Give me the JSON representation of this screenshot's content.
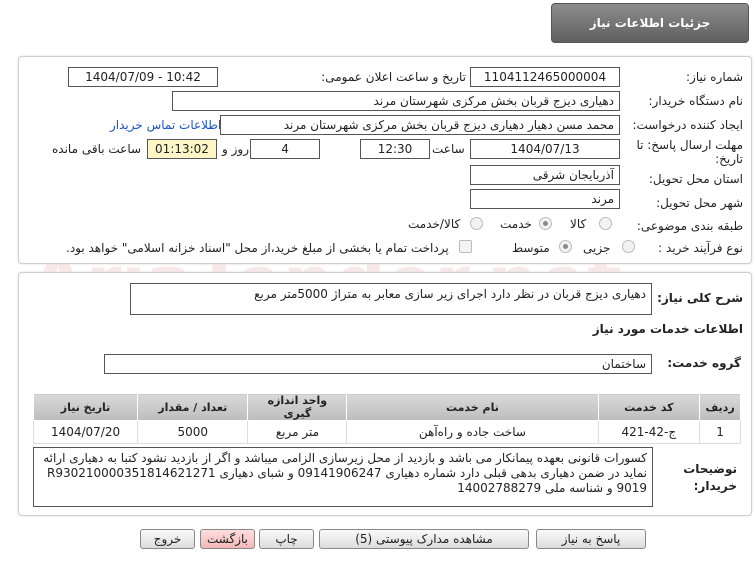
{
  "header": {
    "title": "جزئیات اطلاعات نیاز"
  },
  "form": {
    "need_number_label": "شماره نیاز:",
    "need_number": "1104112465000004",
    "announce_label": "تاریخ و ساعت اعلان عمومی:",
    "announce_value": "1404/07/09 - 10:42",
    "buyer_org_label": "نام دستگاه خریدار:",
    "buyer_org": "دهیاری دیزج قربان بخش مرکزی شهرستان مرند",
    "creator_label": "ایجاد کننده درخواست:",
    "creator": "محمد مسن دهیار دهیاری دیزج قربان بخش مرکزی شهرستان مرند",
    "contact_link": "اطلاعات تماس خریدار",
    "deadline_label_1": "مهلت ارسال پاسخ: تا",
    "deadline_label_2": "تاریخ:",
    "deadline_date": "1404/07/13",
    "time_label": "ساعت",
    "deadline_time": "12:30",
    "days_value": "4",
    "days_label": "روز و",
    "remaining_time": "01:13:02",
    "remaining_label": "ساعت باقی مانده",
    "province_label": "استان محل تحویل:",
    "province": "آذربایجان شرقی",
    "city_label": "شهر محل تحویل:",
    "city": "مرند",
    "category_label": "طبقه بندی موضوعی:",
    "category_options": [
      "کالا",
      "خدمت",
      "کالا/خدمت"
    ],
    "process_label": "نوع فرآیند خرید :",
    "process_options": [
      "جزیی",
      "متوسط"
    ],
    "payment_note": "پرداخت تمام یا بخشی از مبلغ خرید،از محل \"اسناد خزانه اسلامی\" خواهد بود."
  },
  "need": {
    "desc_label": "شرح کلی نیاز:",
    "desc": "دهیاری دیزج قربان در نظر دارد اجرای زیر سازی معابر به متراژ 5000متر مربع",
    "services_heading": "اطلاعات خدمات مورد نیاز",
    "service_group_label": "گروه خدمت:",
    "service_group": "ساختمان"
  },
  "table": {
    "headers": [
      "ردیف",
      "کد خدمت",
      "نام خدمت",
      "واحد اندازه گیری",
      "تعداد / مقدار",
      "تاریخ نیاز"
    ],
    "rows": [
      [
        "1",
        "ج-42-421",
        "ساخت جاده و راه‌آهن",
        "متر مربع",
        "5000",
        "1404/07/20"
      ]
    ]
  },
  "notes": {
    "label_1": "توضیحات",
    "label_2": "خریدار:",
    "text": "کسورات قانونی بعهده پیمانکار می باشد و بازدید از محل زیرسازی الزامی میباشد و اگر از بازدید نشود کتبا به دهیاری ارائه نماید در ضمن دهیاری بدهی قبلی دارد شماره دهیاری 09141906247 و شبای دهیاری R930210000351814621271 9019 و شناسه ملی 14002788279"
  },
  "buttons": {
    "reply": "پاسخ به نیاز",
    "attachments": "مشاهده مدارک پیوستی (5)",
    "print": "چاپ",
    "back": "بازگشت",
    "exit": "خروج"
  },
  "watermark": {
    "text": "AriaTender.net"
  }
}
